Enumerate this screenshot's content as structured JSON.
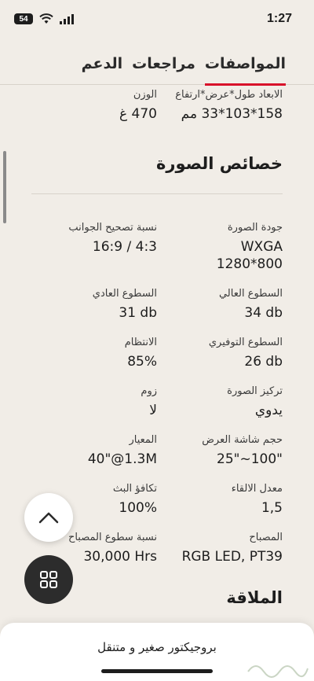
{
  "status_bar": {
    "time": "1:27",
    "battery": "54"
  },
  "tabs": [
    {
      "label": "المواصفات",
      "active": true
    },
    {
      "label": "مراجعات",
      "active": false
    },
    {
      "label": "الدعم",
      "active": false
    }
  ],
  "top_specs": [
    {
      "label": "الابعاد طول*عرض*ارتفاع",
      "value": "158*103*33 مم"
    },
    {
      "label": "الوزن",
      "value": "470 غ"
    }
  ],
  "section_title": "خصائص الصورة",
  "image_specs": [
    {
      "label": "جودة الصورة",
      "value": "WXGA\n1280*800"
    },
    {
      "label": "نسبة تصحيح الجوانب",
      "value": "16:9 / 4:3"
    },
    {
      "label": "السطوع العالي",
      "value": "34 db"
    },
    {
      "label": "السطوع العادي",
      "value": "31 db"
    },
    {
      "label": "السطوع التوفيري",
      "value": "26 db"
    },
    {
      "label": "الانتظام",
      "value": "85%"
    },
    {
      "label": "تركيز الصورة",
      "value": "يدوي"
    },
    {
      "label": "زوم",
      "value": "لا"
    },
    {
      "label": "حجم شاشة العرض",
      "value": "25\"~100\""
    },
    {
      "label": "المعيار",
      "value": "40\"@1.3M"
    },
    {
      "label": "معدل الالقاء",
      "value": "1,5"
    },
    {
      "label": "تكافؤ البث",
      "value": "100%"
    },
    {
      "label": "المصباح",
      "value": "RGB LED, PT39"
    },
    {
      "label": "نسبة سطوع المصباح",
      "value": "30,000 Hrs"
    }
  ],
  "next_section_partial": "الملاقة",
  "bottom_sheet": {
    "title": "بروجيكتور صغير و متنقل"
  },
  "colors": {
    "accent": "#d8102a",
    "background": "#f1ede7",
    "fab_dark": "#2c2c2c"
  },
  "icons": {
    "up": "chevron-up-icon",
    "grid": "grid-icon"
  }
}
